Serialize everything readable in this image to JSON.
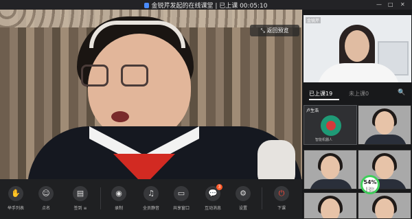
{
  "window": {
    "title": "金锐芹发起的在线课堂 | 已上课 00:05:10",
    "minimize": "—",
    "maximize": "□",
    "close": "✕"
  },
  "main_video": {
    "exit_button_label": "⤡ 返回预览"
  },
  "toolbar": {
    "items": [
      {
        "name": "raise-hand",
        "icon": "✋",
        "label": "举手列表"
      },
      {
        "name": "roll-call",
        "icon": "☺",
        "label": "点名"
      },
      {
        "name": "whiteboard",
        "icon": "▤",
        "label": "签到 ≡"
      },
      {
        "name": "record",
        "icon": "◉",
        "label": "录制"
      },
      {
        "name": "mute-all",
        "icon": "♫",
        "label": "全员静音"
      },
      {
        "name": "share-screen",
        "icon": "▭",
        "label": "共享窗口"
      },
      {
        "name": "chat",
        "icon": "💬",
        "label": "互动消息",
        "badge": "3"
      },
      {
        "name": "settings",
        "icon": "⚙",
        "label": "设置"
      },
      {
        "name": "end-class",
        "icon": "⏻",
        "label": "下课"
      }
    ]
  },
  "sidebar": {
    "teacher_name": "金锐芹",
    "tabs": [
      {
        "label": "已上课19",
        "active": true
      },
      {
        "label": "未上课0",
        "active": false
      }
    ],
    "search_icon": "🔍",
    "participants": [
      {
        "name": "卢生浩",
        "type": "avatar",
        "sub": "智能机器人"
      },
      {
        "name": "",
        "type": "video"
      },
      {
        "name": "",
        "type": "video"
      },
      {
        "name": "",
        "type": "video"
      },
      {
        "name": "",
        "type": "video"
      },
      {
        "name": "",
        "type": "video"
      }
    ],
    "network_meter": {
      "value": "54%",
      "unit": "0.1K/s 0.2K/s"
    }
  }
}
